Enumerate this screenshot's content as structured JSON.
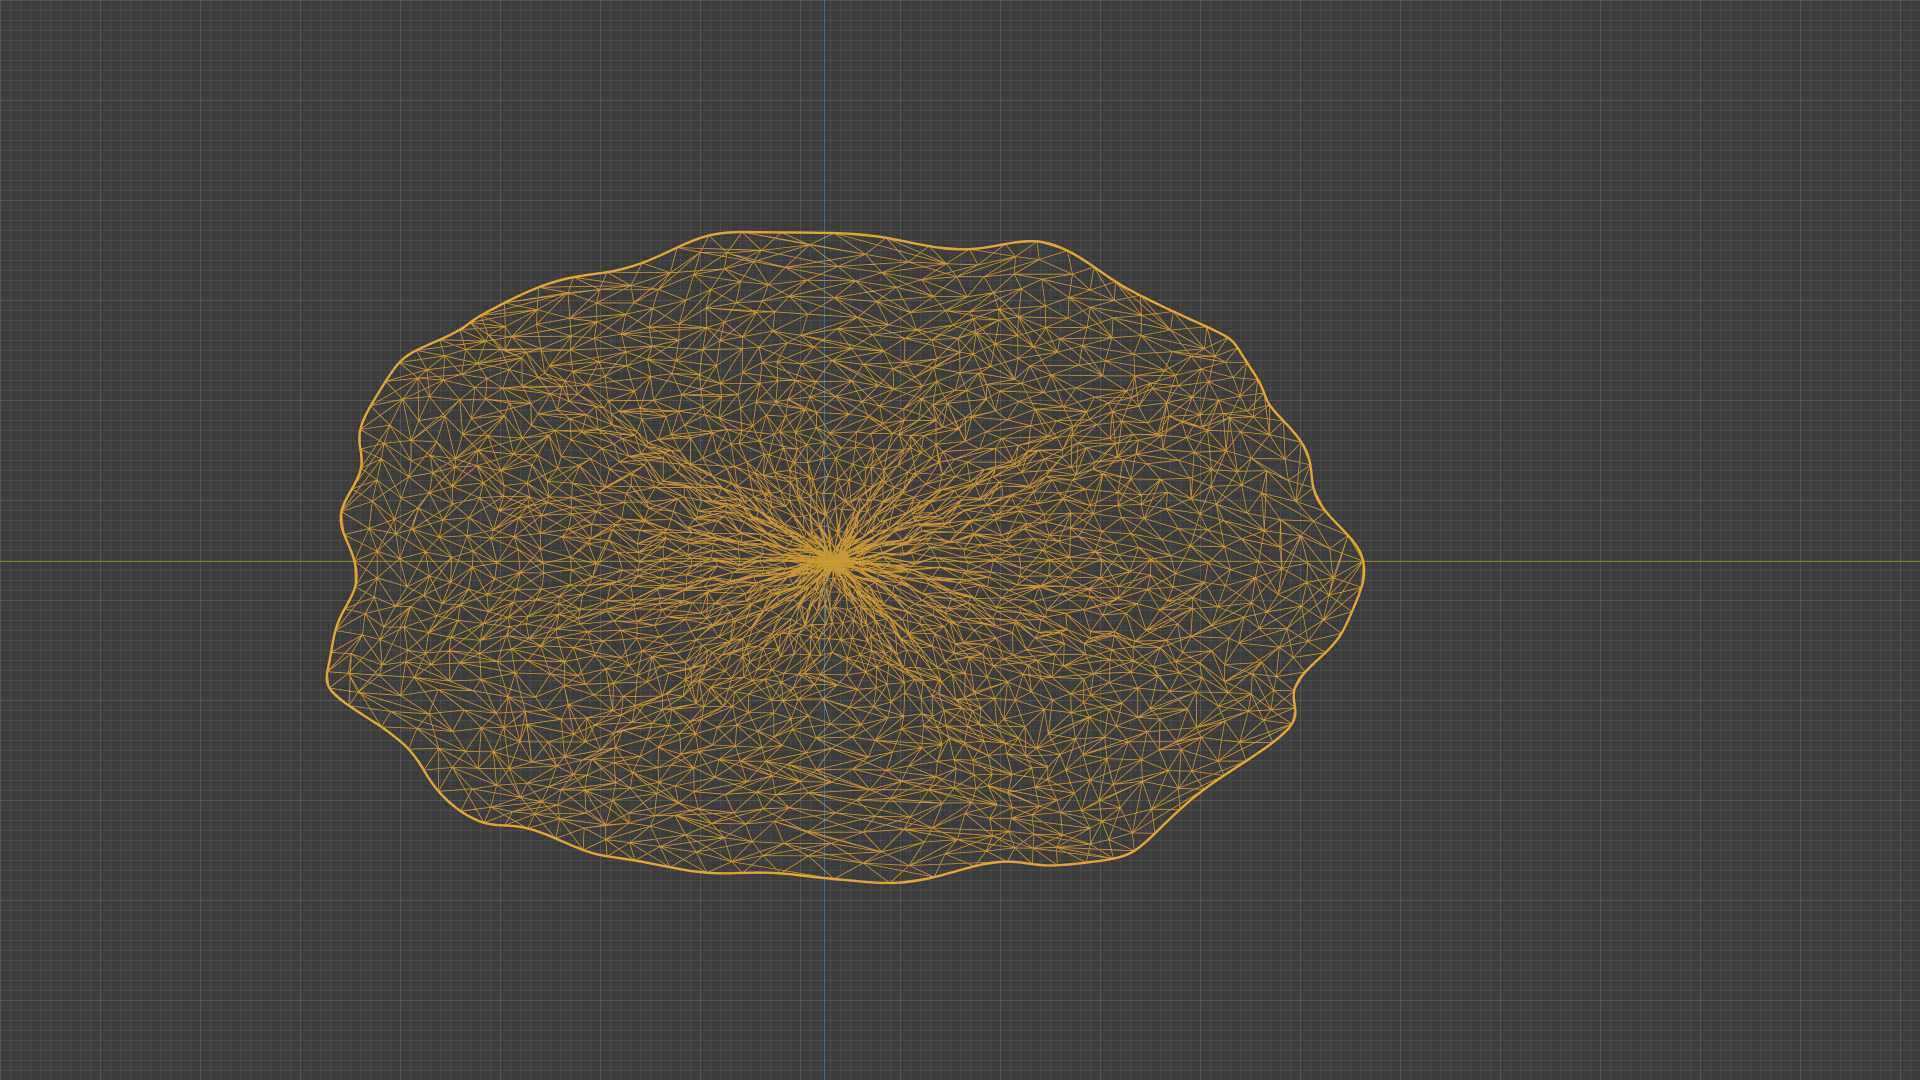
{
  "viewport": {
    "background_color": "#3d3d3d",
    "x_axis_color": "#8a7f2c",
    "z_axis_color": "#3b6f9e"
  },
  "object": {
    "display_mode": "wireframe",
    "selected": true,
    "wire_color": "#e0a632"
  }
}
